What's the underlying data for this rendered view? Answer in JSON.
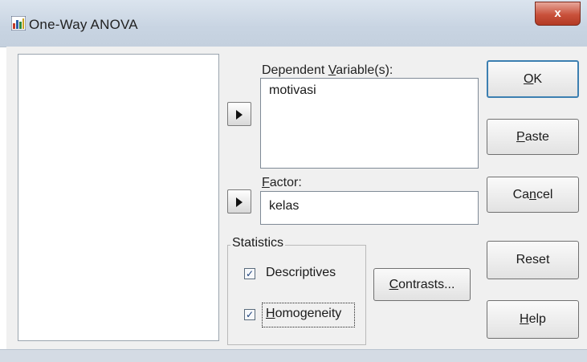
{
  "window": {
    "title": "One-Way ANOVA",
    "close_glyph": "x"
  },
  "source_list": {
    "items": []
  },
  "dependent": {
    "label_pre": "Dependent ",
    "label_key": "V",
    "label_post": "ariable(s):",
    "items": [
      "motivasi"
    ]
  },
  "factor": {
    "label_key": "F",
    "label_post": "actor:",
    "value": "kelas"
  },
  "statistics": {
    "title": "Statistics",
    "descriptives": {
      "label": "Descriptives",
      "checked": true
    },
    "homogeneity": {
      "label_key": "H",
      "label_post": "omogeneity",
      "checked": true
    }
  },
  "buttons": {
    "contrasts": {
      "key": "C",
      "rest": "ontrasts..."
    },
    "ok": {
      "key": "O",
      "rest": "K"
    },
    "paste": {
      "key": "P",
      "rest": "aste"
    },
    "cancel": {
      "pre": "Ca",
      "key": "n",
      "rest": "cel"
    },
    "reset": {
      "label": "Reset"
    },
    "help": {
      "key": "H",
      "rest": "elp"
    }
  },
  "icons": {
    "app": "spss-chart-icon",
    "move_arrow": "right-arrow-icon"
  }
}
